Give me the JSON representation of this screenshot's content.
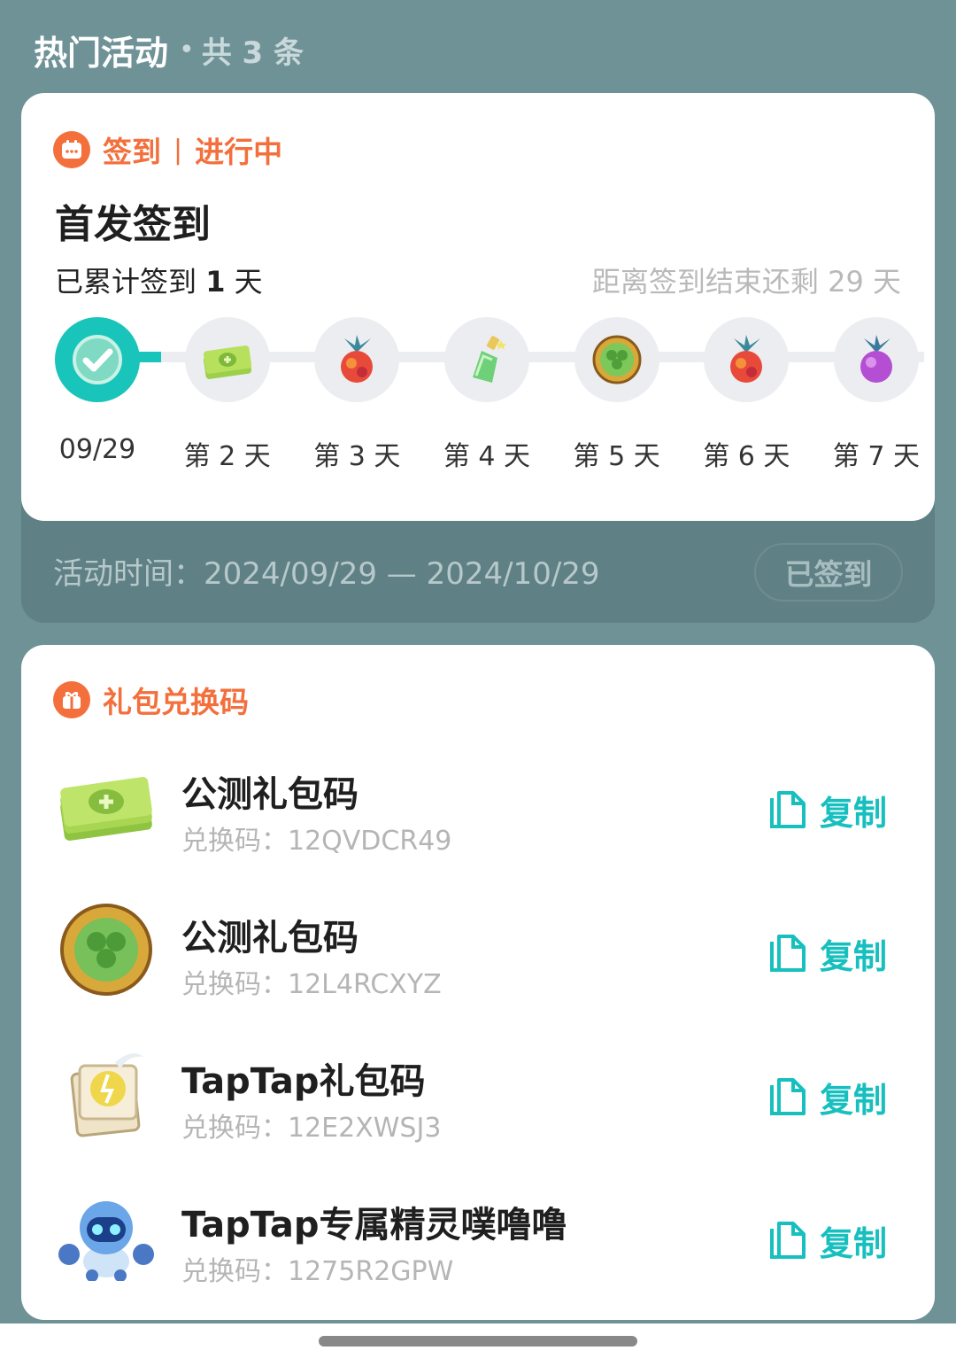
{
  "header": {
    "title": "热门活动",
    "separator": "•",
    "count_text": "共 3 条"
  },
  "signin": {
    "category": "签到",
    "separator": "|",
    "status": "进行中",
    "title": "首发签到",
    "progress_prefix": "已累计签到",
    "progress_days": "1",
    "progress_suffix": "天",
    "remaining": "距离签到结束还剩 29 天",
    "days": [
      {
        "label": "09/29",
        "icon": "check-icon",
        "done": true
      },
      {
        "label": "第 2 天",
        "icon": "cash-stack-icon",
        "done": false
      },
      {
        "label": "第 3 天",
        "icon": "berry-icon",
        "done": false
      },
      {
        "label": "第 4 天",
        "icon": "potion-bottle-icon",
        "done": false
      },
      {
        "label": "第 5 天",
        "icon": "clover-coin-icon",
        "done": false
      },
      {
        "label": "第 6 天",
        "icon": "berry-icon",
        "done": false
      },
      {
        "label": "第 7 天",
        "icon": "purple-berry-icon",
        "done": false
      }
    ],
    "activity_time": "活动时间：2024/09/29 — 2024/10/29",
    "signed_button": "已签到"
  },
  "gift": {
    "title": "礼包兑换码",
    "items": [
      {
        "name": "公测礼包码",
        "code": "兑换码：12QVDCR49",
        "icon": "cash-stack-icon",
        "copy": "复制"
      },
      {
        "name": "公测礼包码",
        "code": "兑换码：12L4RCXYZ",
        "icon": "clover-coin-icon",
        "copy": "复制"
      },
      {
        "name": "TapTap礼包码",
        "code": "兑换码：12E2XWSJ3",
        "icon": "scroll-book-icon",
        "copy": "复制"
      },
      {
        "name": "TapTap专属精灵噗噜噜",
        "code": "兑换码：1275R2GPW",
        "icon": "robot-sprite-icon",
        "copy": "复制"
      }
    ]
  },
  "colors": {
    "accent_orange": "#f36f3c",
    "accent_teal": "#19c4bb",
    "background": "#6f9297"
  }
}
